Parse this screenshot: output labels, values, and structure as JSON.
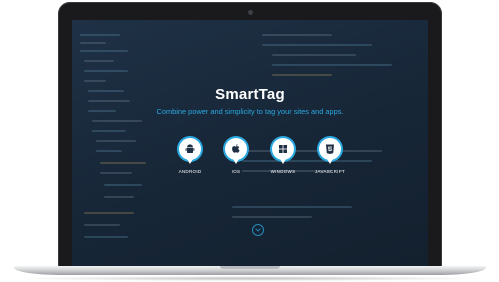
{
  "hero": {
    "title": "SmartTag",
    "subtitle": "Combine power and simplicity to tag your sites and apps."
  },
  "platforms": [
    {
      "label": "ANDROID",
      "icon": "android-icon"
    },
    {
      "label": "IOS",
      "icon": "apple-icon"
    },
    {
      "label": "WINDOWS",
      "icon": "windows-icon"
    },
    {
      "label": "JAVASCRIPT",
      "icon": "html5-icon"
    }
  ],
  "scroll": {
    "icon": "chevron-down-icon"
  },
  "colors": {
    "accent": "#2aa8e0",
    "screen_bg": "#1a2b3d",
    "laptop_bezel": "#1a1a1c",
    "text": "#ffffff"
  }
}
